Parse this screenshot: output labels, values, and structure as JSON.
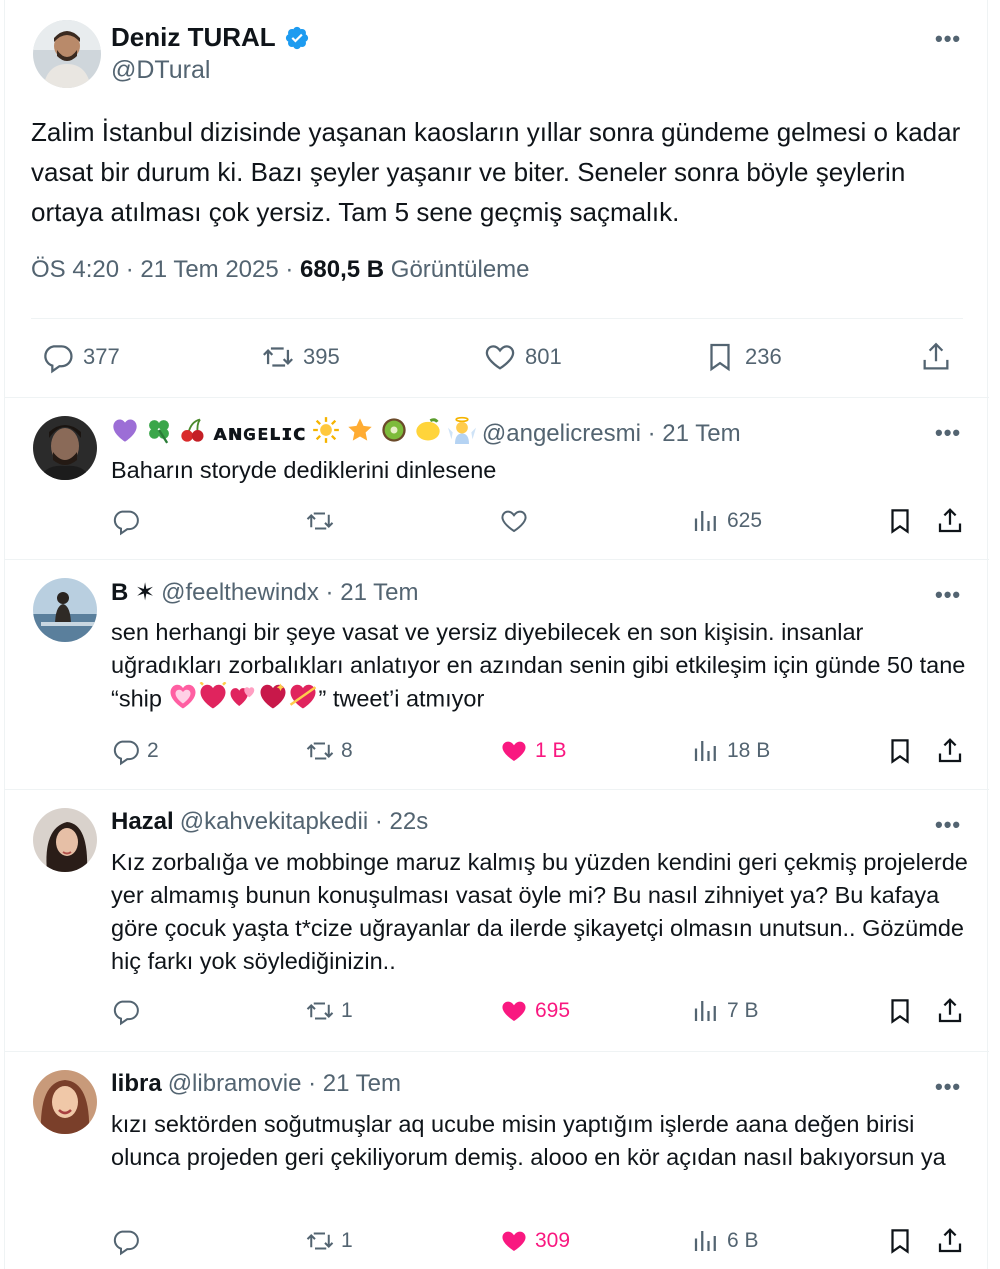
{
  "main_tweet": {
    "display_name": "Deniz TURAL",
    "handle": "@DTural",
    "text": "Zalim İstanbul dizisinde yaşanan kaosların yıllar sonra gündeme gelmesi o kadar vasat bir durum ki. Bazı şeyler yaşanır ve biter. Seneler sonra böyle şeylerin ortaya atılması çok yersiz. Tam 5 sene geçmiş saçmalık.",
    "time": "ÖS 4:20 · 21 Tem 2025 · ",
    "views": "680,5 B",
    "views_label": " Görüntüleme",
    "replies": "377",
    "reposts": "395",
    "likes": "801",
    "bookmarks": "236",
    "verified_color": "#1d9bf0"
  },
  "replies": [
    {
      "display_name": "ᴀɴɢᴇʟɪᴄ",
      "handle": "@angelicresmi · 21 Tem",
      "text": "Baharın storyde dediklerini dinlesene",
      "replies": "",
      "reposts": "",
      "likes": "",
      "views": "625",
      "liked": false
    },
    {
      "display_name": "B ✶",
      "handle": "@feelthewindx · 21 Tem",
      "text_before": "sen herhangi bir şeye vasat ve yersiz diyebilecek en son kişisin. insanlar uğradıkları zorbalıkları anlatıyor en azından senin gibi etkileşim için günde 50 tane “ship ",
      "text_after": "” tweet’i atmıyor",
      "replies": "2",
      "reposts": "8",
      "likes": "1 B",
      "views": "18 B",
      "liked": true
    },
    {
      "display_name": "Hazal",
      "handle": "@kahvekitapkedii · 22s",
      "text": "Kız zorbalığa ve mobbinge maruz kalmış bu yüzden kendini geri çekmiş projelerde yer almamış bunun konuşulması vasat öyle mi? Bu nasıl zihniyet ya? Bu kafaya göre çocuk yaşta t*cize uğrayanlar da ilerde şikayetçi olmasın unutsun.. Gözümde hiç farkı yok söylediğinizin..",
      "replies": "",
      "reposts": "1",
      "likes": "695",
      "views": "7 B",
      "liked": true
    },
    {
      "display_name": "libra",
      "handle": "@libramovie · 21 Tem",
      "text": "kızı sektörden soğutmuşlar aq ucube misin yaptığım işlerde aana değen birisi olunca projeden geri çekiliyorum demiş. alooo en kör açıdan nasıl bakıyorsun ya",
      "replies": "",
      "reposts": "1",
      "likes": "309",
      "views": "6 B",
      "liked": true
    }
  ],
  "colors": {
    "like_active": "#f91880",
    "muted": "#536471",
    "text": "#0f1419"
  }
}
